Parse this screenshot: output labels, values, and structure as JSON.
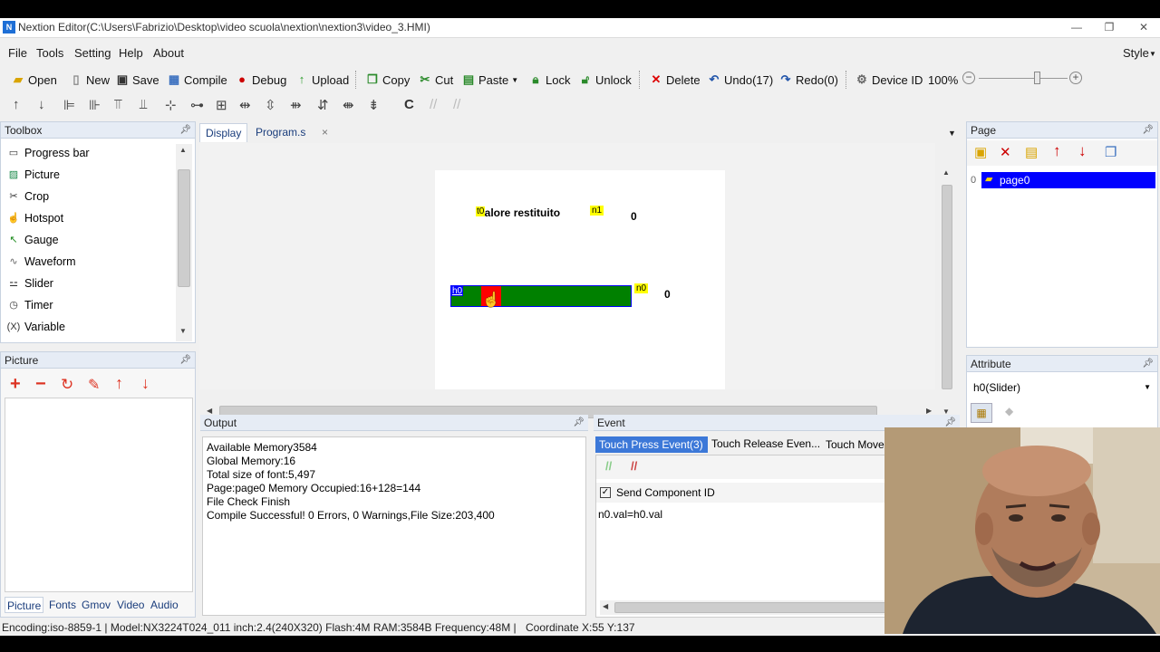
{
  "window": {
    "title": "Nextion Editor(C:\\Users\\Fabrizio\\Desktop\\video scuola\\nextion\\nextion3\\video_3.HMI)",
    "logo_text": "N",
    "min_glyph": "—",
    "restore_glyph": "❐",
    "close_glyph": "✕"
  },
  "menu": {
    "file": "File",
    "tools": "Tools",
    "setting": "Setting",
    "help": "Help",
    "about": "About",
    "style": "Style"
  },
  "toolbar": {
    "open": "Open",
    "new": "New",
    "save": "Save",
    "compile": "Compile",
    "debug": "Debug",
    "upload": "Upload",
    "copy": "Copy",
    "cut": "Cut",
    "paste": "Paste",
    "lock": "Lock",
    "unlock": "Unlock",
    "delete": "Delete",
    "undo": "Undo(17)",
    "redo": "Redo(0)",
    "device_id": "Device ID",
    "zoom": "100%",
    "zoom_level": 0.65
  },
  "toolbox": {
    "header": "Toolbox",
    "items": [
      {
        "label": "Progress bar",
        "icon": "progress-bar-icon"
      },
      {
        "label": "Picture",
        "icon": "picture-icon"
      },
      {
        "label": "Crop",
        "icon": "crop-icon"
      },
      {
        "label": "Hotspot",
        "icon": "hotspot-icon"
      },
      {
        "label": "Gauge",
        "icon": "gauge-icon"
      },
      {
        "label": "Waveform",
        "icon": "waveform-icon"
      },
      {
        "label": "Slider",
        "icon": "slider-icon"
      },
      {
        "label": "Timer",
        "icon": "timer-icon"
      },
      {
        "label": "Variable",
        "icon": "variable-icon"
      }
    ]
  },
  "picture_panel": {
    "header": "Picture",
    "tabs": [
      "Picture",
      "Fonts",
      "Gmov",
      "Video",
      "Audio"
    ]
  },
  "editor": {
    "tabs": [
      "Display",
      "Program.s"
    ],
    "tab_close": "×",
    "canvas": {
      "t0_tag": "t0",
      "t0_text": "valore restituito",
      "n1_tag": "n1",
      "n1_value": "0",
      "h0_tag": "h0",
      "n0_tag": "n0",
      "n0_value": "0",
      "slider_colors": {
        "track": "#008000",
        "thumb": "#ff0000",
        "selection": "#0000ff",
        "tag_bg": "#ffff00"
      }
    }
  },
  "page_panel": {
    "header": "Page",
    "pages": [
      {
        "index": "0",
        "name": "page0"
      }
    ]
  },
  "attribute_panel": {
    "header": "Attribute",
    "selected": "h0(Slider)"
  },
  "output": {
    "header": "Output",
    "lines": [
      "Available Memory3584",
      "Global Memory:16",
      "Total size of font:5,497",
      "Page:page0 Memory Occupied:16+128=144",
      "File Check Finish",
      "Compile Successful! 0 Errors, 0 Warnings,File Size:203,400"
    ]
  },
  "event": {
    "header": "Event",
    "tabs": [
      "Touch Press Event(3)",
      "Touch Release Even...",
      "Touch Move"
    ],
    "send_component_id": "Send Component ID",
    "code": "n0.val=h0.val"
  },
  "statusbar": {
    "text": "Encoding:iso-8859-1 | Model:NX3224T024_011 inch:2.4(240X320) Flash:4M RAM:3584B Frequency:48M |",
    "coordinate": "Coordinate X:55  Y:137"
  },
  "colors": {
    "selection_blue": "#0000ff",
    "tab_active_blue": "#3c78d8",
    "panel_header": "#e6ecf5"
  }
}
